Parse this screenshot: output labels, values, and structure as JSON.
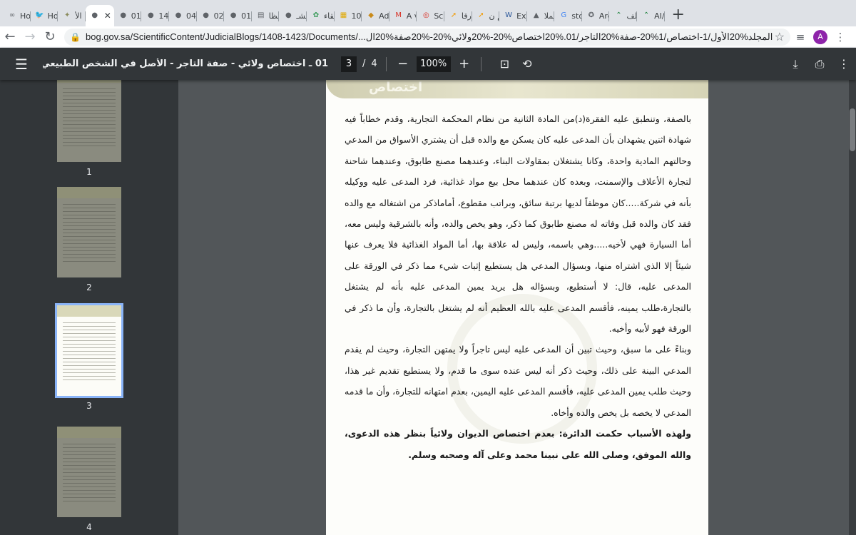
{
  "tabs": [
    {
      "title": "Ho",
      "icon": "link-icon",
      "color": "#5f6368"
    },
    {
      "title": "Ho",
      "icon": "twitter-icon",
      "color": "#1d9bf0"
    },
    {
      "title": "الأ",
      "icon": "emblem-icon",
      "color": "#8a8b5c"
    },
    {
      "title": "",
      "icon": "globe-icon",
      "color": "#5f6368",
      "active": true
    },
    {
      "title": "01",
      "icon": "globe-icon",
      "color": "#5f6368"
    },
    {
      "title": "14",
      "icon": "globe-icon",
      "color": "#5f6368"
    },
    {
      "title": "04",
      "icon": "globe-icon",
      "color": "#5f6368"
    },
    {
      "title": "02",
      "icon": "globe-icon",
      "color": "#5f6368"
    },
    {
      "title": "01",
      "icon": "globe-icon",
      "color": "#5f6368"
    },
    {
      "title": "نظا",
      "icon": "document-icon",
      "color": "#5f6368"
    },
    {
      "title": "مشـ",
      "icon": "globe-icon",
      "color": "#5f6368"
    },
    {
      "title": "نقاء",
      "icon": "leaf-icon",
      "color": "#3a9b5a"
    },
    {
      "title": "10",
      "icon": "grid-icon",
      "color": "#e0a800"
    },
    {
      "title": "Ad",
      "icon": "shield-icon",
      "color": "#c98a1a"
    },
    {
      "title": "A v",
      "icon": "gmail-icon",
      "color": "#d93025"
    },
    {
      "title": "Sc",
      "icon": "sc-icon",
      "color": "#d93025"
    },
    {
      "title": "ارقا",
      "icon": "rocket-icon",
      "color": "#f29900"
    },
    {
      "title": "لم ن",
      "icon": "rocket-icon",
      "color": "#f29900"
    },
    {
      "title": "Ex",
      "icon": "word-icon",
      "color": "#2b579a"
    },
    {
      "title": "الملا",
      "icon": "chart-icon",
      "color": "#5f6368"
    },
    {
      "title": "sto",
      "icon": "google-icon",
      "color": "#4285f4"
    },
    {
      "title": "Are",
      "icon": "compass-icon",
      "color": "#5f6368"
    },
    {
      "title": "الف",
      "icon": "caret-icon",
      "color": "#188038"
    },
    {
      "title": "AI/",
      "icon": "caret-icon",
      "color": "#188038"
    }
  ],
  "toolbar": {
    "url": "bog.gov.sa/ScientificContent/JudicialBlogs/1408-1423/Documents/...المجلد%20الأول/1-اختصاص/1%20-صفة%20التاجر/01.%20اختصاص%20-%20ولائي%20-%20صفة%20ال",
    "avatar_letter": "A",
    "avatar_color": "#8e24aa"
  },
  "pdf": {
    "title": "01 ـ اختصاص ولائي - صفة التاجر - الأصل في الشخص الطبيعي عدم اكتساب صفة التاجر إلا ببينة",
    "current_page": "3",
    "page_separator": "/",
    "total_pages": "4",
    "zoom": "100%",
    "header_emblem_text": "اختصاص",
    "thumbnails": [
      "1",
      "2",
      "3",
      "4"
    ],
    "active_thumbnail": 3,
    "paragraphs": [
      "بالصفة، وتنطبق عليه الفقرة(د)من المادة الثانية من نظام المحكمة التجارية، وقدم خطاباً فيه شهادة اثنين يشهدان بأن المدعى عليه كان يسكن مع والده قبل أن يشتري الأسواق من المدعي وحالتهم المادية واحدة، وكانا يشتغلان بمقاولات البناء، وعندهما مصنع طابوق، وعندهما شاحنة لتجارة الأعلاف والإسمنت، وبعده كان عندهما محل بيع مواد غذائية، فرد المدعى عليه ووكيله بأنه في شركة.....كان موظفاً لديها برتبة سائق، وبراتب مقطوع، أماماذكر من اشتغاله مع والده فقد كان والده قبل وفاته له مصنع طابوق كما ذكر، وهو يخص والده، وأنه بالشرقية وليس معه، أما السيارة فهي لأخيه.....وهي باسمه، وليس له علاقة بها، أما المواد الغذائية فلا يعرف عنها شيئاً إلا الذي اشتراه منها، وبسؤال المدعي هل يستطيع إثبات شيء مما ذكر في الورقة على المدعى عليه، قال: لا أستطيع، وبسؤاله هل يريد يمين المدعى عليه بأنه لم يشتغل بالتجارة،طلب يمينه، فأقسم المدعى عليه بالله العظيم أنه لم يشتغل بالتجارة، وأن ما ذكر في الورقة فهو لأبيه وأخيه.",
      "وبناءً على ما سبق، وحيث تبين أن المدعى عليه ليس تاجراً ولا يمتهن التجارة، وحيث لم يقدم المدعي البينة على ذلك، وحيث ذكر أنه ليس عنده سوى ما قدم، ولا يستطيع تقديم غير هذا، وحيث طلب يمين المدعى عليه، فأقسم المدعى عليه اليمين، بعدم امتهانه للتجارة، وأن ما قدمه المدعي لا يخصه بل يخص والده وأخاه.",
      "ولهذه الأسباب حكمت الدائرة: بعدم اختصاص الديوان ولائياً بنظر هذه الدعوى، والله الموفق، وصلى الله على نبينا محمد وعلى آله وصحبه وسلم."
    ]
  }
}
